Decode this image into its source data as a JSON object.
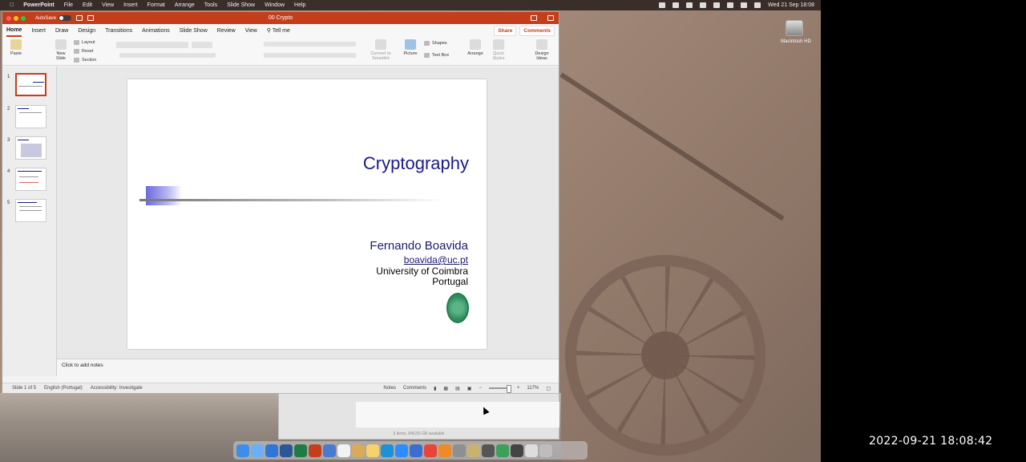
{
  "menubar": {
    "app_name": "PowerPoint",
    "items": [
      "File",
      "Edit",
      "View",
      "Insert",
      "Format",
      "Arrange",
      "Tools",
      "Slide Show",
      "Window",
      "Help"
    ],
    "datetime": "Wed 21 Sep  18:08"
  },
  "desktop": {
    "drive_label": "Macintosh HD"
  },
  "window": {
    "autosave_label": "AutoSave",
    "autosave_state": "OFF",
    "document_title": "00 Crypto",
    "tabs": [
      "Home",
      "Insert",
      "Draw",
      "Design",
      "Transitions",
      "Animations",
      "Slide Show",
      "Review",
      "View"
    ],
    "tell_me": "Tell me",
    "share_label": "Share",
    "comments_label": "Comments"
  },
  "ribbon": {
    "paste": "Paste",
    "new_slide": "New Slide",
    "layout": "Layout",
    "reset": "Reset",
    "section": "Section",
    "convert_smartart": "Convert to SmartArt",
    "picture": "Picture",
    "shapes": "Shapes",
    "text_box": "Text Box",
    "arrange": "Arrange",
    "quick_styles": "Quick Styles",
    "design_ideas": "Design Ideas"
  },
  "thumbnails": [
    "1",
    "2",
    "3",
    "4",
    "5"
  ],
  "slide": {
    "title": "Cryptography",
    "author_name": "Fernando Boavida",
    "author_email": "boavida@uc.pt",
    "university": "University of Coimbra",
    "country": "Portugal"
  },
  "notes_placeholder": "Click to add notes",
  "statusbar": {
    "slide_counter": "Slide 1 of 5",
    "language": "English (Portugal)",
    "accessibility": "Accessibility: Investigate",
    "notes": "Notes",
    "comments": "Comments",
    "zoom": "117%"
  },
  "finder": {
    "status": "3 items, 840,55 GB available"
  },
  "overlay_timestamp": "2022-09-21  18:08:42",
  "colors": {
    "accent": "#c43e1c",
    "title_blue": "#1a1a8c"
  }
}
